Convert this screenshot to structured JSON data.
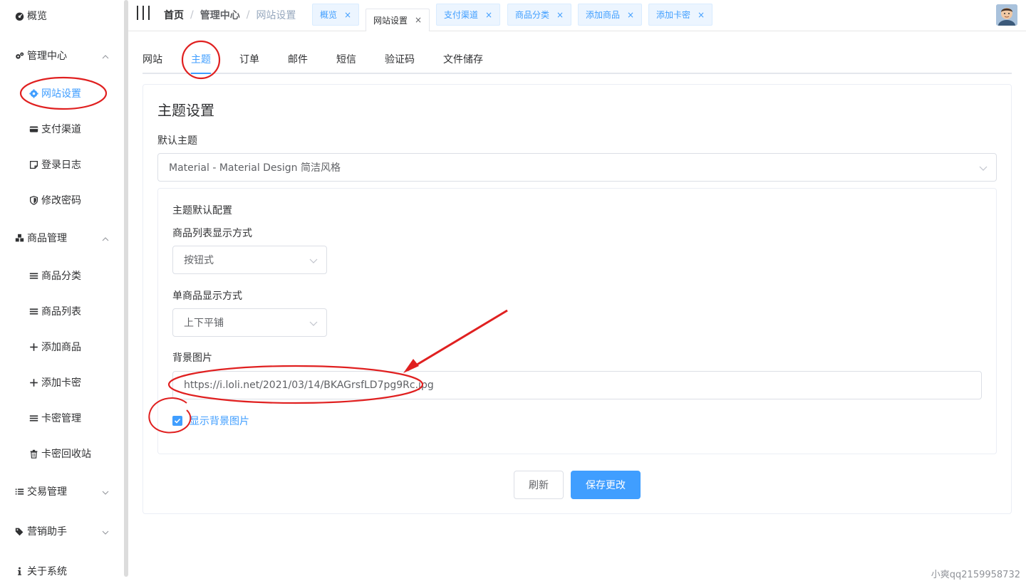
{
  "sidebar": {
    "items": [
      {
        "label": "概览",
        "icon": "dashboard-icon"
      },
      {
        "label": "管理中心",
        "icon": "gears-icon"
      },
      {
        "label": "网站设置",
        "icon": "gear-icon"
      },
      {
        "label": "支付渠道",
        "icon": "credit-card-icon"
      },
      {
        "label": "登录日志",
        "icon": "sticky-note-icon"
      },
      {
        "label": "修改密码",
        "icon": "shield-icon"
      },
      {
        "label": "商品管理",
        "icon": "cubes-icon"
      },
      {
        "label": "商品分类",
        "icon": "bars-icon"
      },
      {
        "label": "商品列表",
        "icon": "bars-icon"
      },
      {
        "label": "添加商品",
        "icon": "plus-icon"
      },
      {
        "label": "添加卡密",
        "icon": "plus-icon"
      },
      {
        "label": "卡密管理",
        "icon": "bars-icon"
      },
      {
        "label": "卡密回收站",
        "icon": "trash-icon"
      },
      {
        "label": "交易管理",
        "icon": "list-icon"
      },
      {
        "label": "营销助手",
        "icon": "tags-icon"
      },
      {
        "label": "关于系统",
        "icon": "info-icon"
      }
    ]
  },
  "header": {
    "breadcrumb": [
      "首页",
      "管理中心",
      "网站设置"
    ],
    "breadcrumb_sep": "/",
    "tags": [
      "概览",
      "网站设置",
      "支付渠道",
      "商品分类",
      "添加商品",
      "添加卡密"
    ],
    "tag_close": "×"
  },
  "tabs": [
    "网站",
    "主题",
    "订单",
    "邮件",
    "短信",
    "验证码",
    "文件储存"
  ],
  "theme": {
    "title": "主题设置",
    "default_theme_label": "默认主题",
    "default_theme_value": "Material - Material Design 简洁风格",
    "config_title": "主题默认配置",
    "list_mode_label": "商品列表显示方式",
    "list_mode_value": "按钮式",
    "single_mode_label": "单商品显示方式",
    "single_mode_value": "上下平铺",
    "bg_label": "背景图片",
    "bg_value": "https://i.loli.net/2021/03/14/BKAGrsfLD7pg9Rc.jpg",
    "show_bg_label": "显示背景图片",
    "show_bg_checked": true,
    "refresh_button": "刷新",
    "save_button": "保存更改"
  },
  "watermark": "小爽qq2159958732",
  "colors": {
    "accent": "#409eff",
    "annotation": "#e02020"
  }
}
